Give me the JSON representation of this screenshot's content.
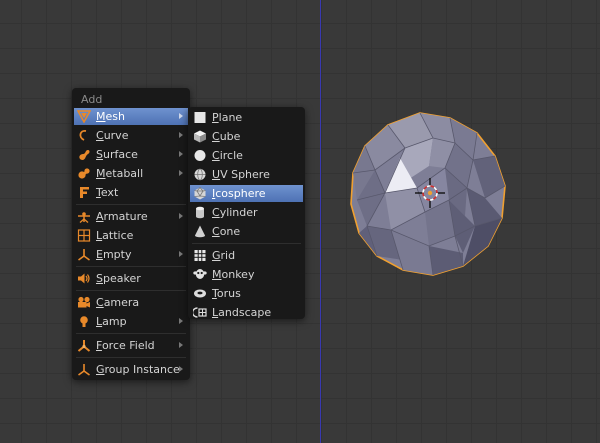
{
  "add_menu": {
    "title": "Add",
    "items": [
      {
        "label": "Mesh",
        "icon": "mesh-icon",
        "submenu": true,
        "active": true
      },
      {
        "label": "Curve",
        "icon": "curve-icon",
        "submenu": true
      },
      {
        "label": "Surface",
        "icon": "surface-icon",
        "submenu": true
      },
      {
        "label": "Metaball",
        "icon": "metaball-icon",
        "submenu": true
      },
      {
        "label": "Text",
        "icon": "text-icon",
        "submenu": false
      },
      {
        "label": "Armature",
        "icon": "armature-icon",
        "submenu": true
      },
      {
        "label": "Lattice",
        "icon": "lattice-icon",
        "submenu": false
      },
      {
        "label": "Empty",
        "icon": "empty-icon",
        "submenu": true
      },
      {
        "label": "Speaker",
        "icon": "speaker-icon",
        "submenu": false
      },
      {
        "label": "Camera",
        "icon": "camera-icon",
        "submenu": false
      },
      {
        "label": "Lamp",
        "icon": "lamp-icon",
        "submenu": true
      },
      {
        "label": "Force Field",
        "icon": "force-field-icon",
        "submenu": true
      },
      {
        "label": "Group Instance",
        "icon": "group-instance-icon",
        "submenu": true
      }
    ]
  },
  "mesh_menu": {
    "items": [
      {
        "label": "Plane",
        "icon": "plane-icon"
      },
      {
        "label": "Cube",
        "icon": "cube-icon"
      },
      {
        "label": "Circle",
        "icon": "circle-icon"
      },
      {
        "label": "UV Sphere",
        "icon": "uv-sphere-icon"
      },
      {
        "label": "Icosphere",
        "icon": "icosphere-icon",
        "active": true
      },
      {
        "label": "Cylinder",
        "icon": "cylinder-icon"
      },
      {
        "label": "Cone",
        "icon": "cone-icon"
      },
      {
        "label": "Grid",
        "icon": "grid-icon"
      },
      {
        "label": "Monkey",
        "icon": "monkey-icon"
      },
      {
        "label": "Torus",
        "icon": "torus-icon"
      },
      {
        "label": "Landscape",
        "icon": "landscape-icon"
      }
    ]
  },
  "colors": {
    "background": "#393939",
    "menu_background": "#191919",
    "highlight": "#5c80c2",
    "object_outline": "#f0a030",
    "icon_orange": "#e8892a"
  }
}
